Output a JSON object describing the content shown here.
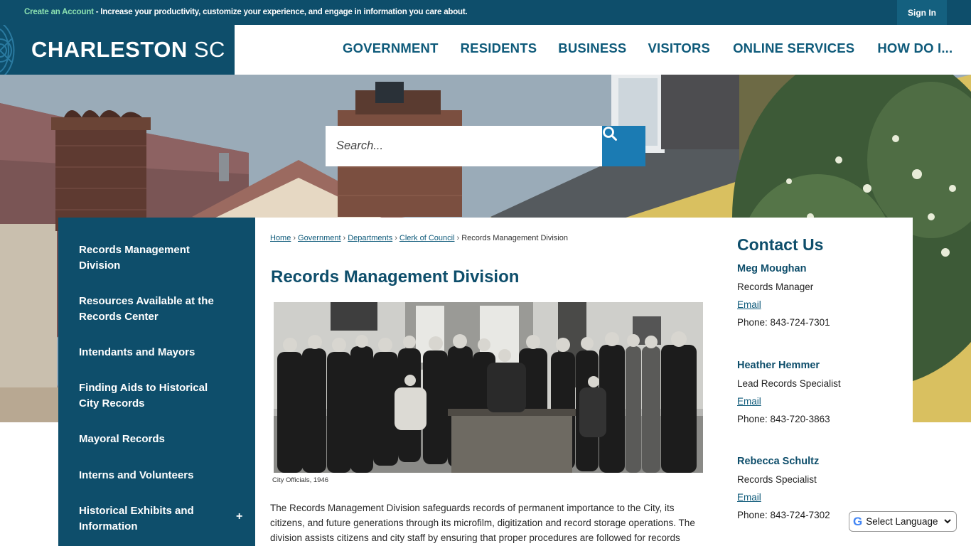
{
  "topbar": {
    "create_label": "Create an Account",
    "message": " - Increase your productivity, customize your experience, and engage in information you care about.",
    "signin_label": "Sign In"
  },
  "header": {
    "logo_bold": "CHARLESTON",
    "logo_light": "SC",
    "nav": [
      "GOVERNMENT",
      "RESIDENTS",
      "BUSINESS",
      "VISITORS",
      "ONLINE SERVICES",
      "HOW DO I..."
    ]
  },
  "search": {
    "placeholder": "Search...",
    "icon": "search-icon"
  },
  "sidebar": {
    "items": [
      {
        "label": "Records Management Division"
      },
      {
        "label": "Resources Available at the Records Center"
      },
      {
        "label": "Intendants and Mayors"
      },
      {
        "label": "Finding Aids to Historical City Records"
      },
      {
        "label": "Mayoral Records"
      },
      {
        "label": "Interns and Volunteers"
      },
      {
        "label": "Historical Exhibits and Information"
      }
    ],
    "expand_symbol": "+"
  },
  "breadcrumb": {
    "items": [
      "Home",
      "Government",
      "Departments",
      "Clerk of Council"
    ],
    "current": "Records Management Division",
    "separator": "›"
  },
  "main": {
    "title": "Records Management Division",
    "photo_caption": "City Officials, 1946",
    "body": "The Records Management Division safeguards records of permanent importance to the City, its citizens, and future generations through its microfilm, digitization and record storage operations. The division assists citizens and city staff by ensuring that proper procedures are followed for records"
  },
  "contact": {
    "heading": "Contact Us",
    "email_label": "Email",
    "people": [
      {
        "name": "Meg Moughan",
        "role": "Records Manager",
        "phone": "Phone: 843-724-7301"
      },
      {
        "name": "Heather Hemmer",
        "role": "Lead Records Specialist",
        "phone": "Phone: 843-720-3863"
      },
      {
        "name": "Rebecca Schultz",
        "role": "Records Specialist",
        "phone": "Phone: 843-724-7302"
      }
    ]
  },
  "translate": {
    "label": "Select Language",
    "logo_letter": "G"
  },
  "colors": {
    "brand_dark": "#0e4e6b",
    "accent_blue": "#1b7bb3",
    "nav_text": "#0e5a7a",
    "account_green": "#8be0b0"
  }
}
